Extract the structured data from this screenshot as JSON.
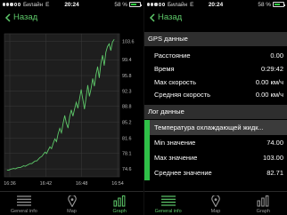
{
  "status": {
    "carrier": "Билайн",
    "network": "E",
    "time": "20:24",
    "battery": "58 %",
    "battery_level": 0.58,
    "signal_bars": 3,
    "signal_total": 5
  },
  "nav": {
    "back_label": "Назад"
  },
  "chart_data": {
    "type": "line",
    "x_ticks": [
      "16:36",
      "16:42",
      "16:48",
      "16:54"
    ],
    "y_ticks": [
      "103.6",
      "99.4",
      "95.8",
      "92.3",
      "88.8",
      "85.2",
      "81.6",
      "78.1",
      "74.6"
    ],
    "ylim": [
      72.8,
      105.3
    ],
    "grid": true,
    "color": "#5ec96a",
    "series": [
      {
        "values": [
          74.3,
          74.3,
          74.5,
          74.6,
          74.7,
          74.6,
          74.8,
          74.9,
          74.9,
          75.1,
          75.3,
          75.2,
          75.4,
          75.6,
          75.8,
          75.8,
          76.1,
          76.4,
          76.4,
          76.8,
          77.2,
          77.4,
          77.9,
          78.4,
          78.1,
          78.9,
          79.6,
          79.2,
          80.4,
          81.4,
          80.8,
          82.6,
          83.8,
          82.8,
          84.9,
          86.7,
          85.0,
          83.9,
          86.4,
          88.0,
          86.6,
          88.2,
          89.7,
          88.4,
          90.5,
          92.6,
          90.4,
          88.2,
          90.8,
          93.6,
          91.1,
          92.8,
          95.1,
          93.4,
          96.0,
          97.8,
          95.3,
          98.6,
          100.4,
          98.1,
          101.1,
          102.4,
          103.0,
          101.5,
          103.4,
          104.0
        ]
      }
    ]
  },
  "tabs": [
    {
      "label": "General info",
      "icon": "list-icon",
      "active": false
    },
    {
      "label": "Map",
      "icon": "map-marker-icon",
      "active": false
    },
    {
      "label": "Graph",
      "icon": "bar-chart-icon",
      "active": true
    }
  ],
  "gps": {
    "header": "GPS данные",
    "rows": [
      {
        "label": "Расстояние",
        "value": "0.00"
      },
      {
        "label": "Время",
        "value": "0:29:42"
      },
      {
        "label": "Max скорость",
        "value": "0.00 км/ч"
      },
      {
        "label": "Средняя скорость",
        "value": "0.00 км/ч"
      }
    ]
  },
  "log": {
    "header": "Лог данные",
    "rows": [
      {
        "label": "Температура охлаждающей жидк...",
        "value": ""
      },
      {
        "label": "Min значение",
        "value": "74.00"
      },
      {
        "label": "Max значение",
        "value": "103.00"
      },
      {
        "label": "Среднее значение",
        "value": "82.71"
      }
    ]
  }
}
